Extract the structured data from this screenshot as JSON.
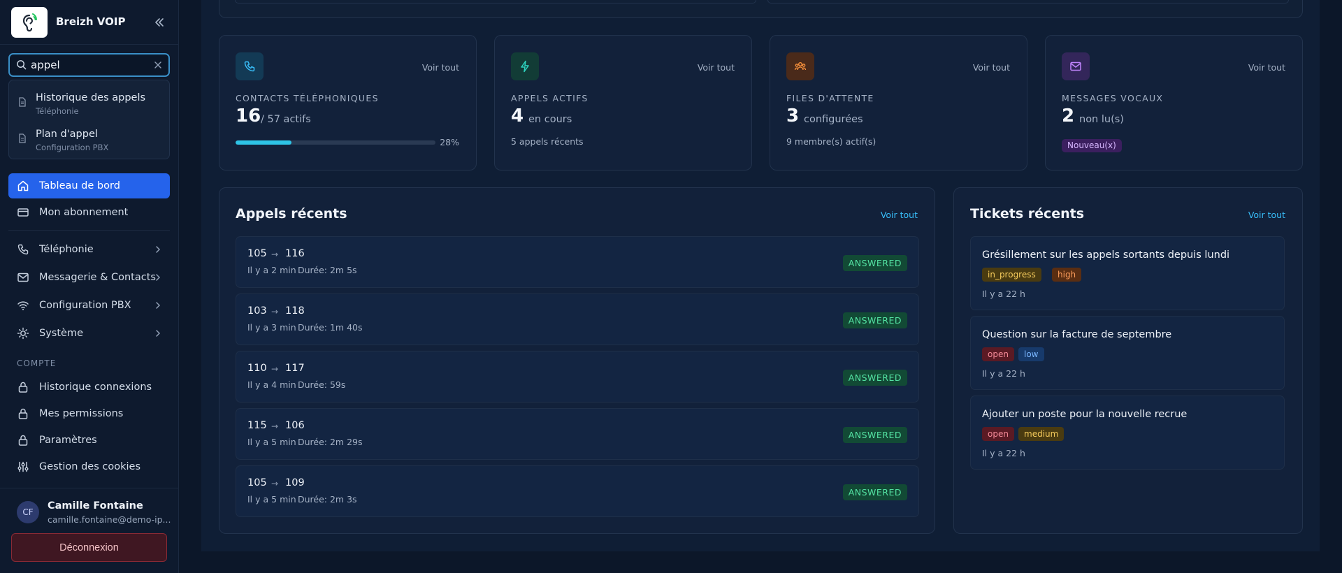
{
  "brand": {
    "name": "Breizh VOIP"
  },
  "search": {
    "value": "appel",
    "results": [
      {
        "title": "Historique des appels",
        "subtitle": "Téléphonie"
      },
      {
        "title": "Plan d'appel",
        "subtitle": "Configuration PBX"
      }
    ]
  },
  "nav": {
    "dashboard": "Tableau de bord",
    "subscription": "Mon abonnement",
    "telephony": "Téléphonie",
    "messaging": "Messagerie & Contacts",
    "pbx": "Configuration PBX",
    "system": "Système",
    "account_section": "COMPTE",
    "login_history": "Historique connexions",
    "permissions": "Mes permissions",
    "settings": "Paramètres",
    "cookies": "Gestion des cookies"
  },
  "user": {
    "initials": "CF",
    "name": "Camille Fontaine",
    "email": "camille.fontaine@demo-ip..."
  },
  "logout_label": "Déconnexion",
  "stats": {
    "see_all": "Voir tout",
    "contacts": {
      "label": "CONTACTS TÉLÉPHONIQUES",
      "value": "16",
      "unit": "/ 57 actifs",
      "progress_pct": 28,
      "progress_label": "28%"
    },
    "active_calls": {
      "label": "APPELS ACTIFS",
      "value": "4",
      "unit": "en cours",
      "footer": "5 appels récents"
    },
    "queues": {
      "label": "FILES D'ATTENTE",
      "value": "3",
      "unit": "configurées",
      "footer": "9 membre(s) actif(s)"
    },
    "voicemail": {
      "label": "MESSAGES VOCAUX",
      "value": "2",
      "unit": "non lu(s)",
      "badge": "Nouveau(x)"
    }
  },
  "recent_calls": {
    "title": "Appels récents",
    "see_all": "Voir tout",
    "items": [
      {
        "from": "105",
        "to": "116",
        "when": "Il y a 2 min",
        "duration": "Durée: 2m 5s",
        "status": "ANSWERED"
      },
      {
        "from": "103",
        "to": "118",
        "when": "Il y a 3 min",
        "duration": "Durée: 1m 40s",
        "status": "ANSWERED"
      },
      {
        "from": "110",
        "to": "117",
        "when": "Il y a 4 min",
        "duration": "Durée: 59s",
        "status": "ANSWERED"
      },
      {
        "from": "115",
        "to": "106",
        "when": "Il y a 5 min",
        "duration": "Durée: 2m 29s",
        "status": "ANSWERED"
      },
      {
        "from": "105",
        "to": "109",
        "when": "Il y a 5 min",
        "duration": "Durée: 2m 3s",
        "status": "ANSWERED"
      }
    ]
  },
  "recent_tickets": {
    "title": "Tickets récents",
    "see_all": "Voir tout",
    "items": [
      {
        "title": "Grésillement sur les appels sortants depuis lundi",
        "status": "in_progress",
        "priority": "high",
        "when": "Il y a 22 h"
      },
      {
        "title": "Question sur la facture de septembre",
        "status": "open",
        "priority": "low",
        "when": "Il y a 22 h"
      },
      {
        "title": "Ajouter un poste pour la nouvelle recrue",
        "status": "open",
        "priority": "medium",
        "when": "Il y a 22 h"
      }
    ]
  },
  "colors": {
    "accent": "#2563eb",
    "success": "#54e3a3",
    "link": "#38bdf8"
  }
}
